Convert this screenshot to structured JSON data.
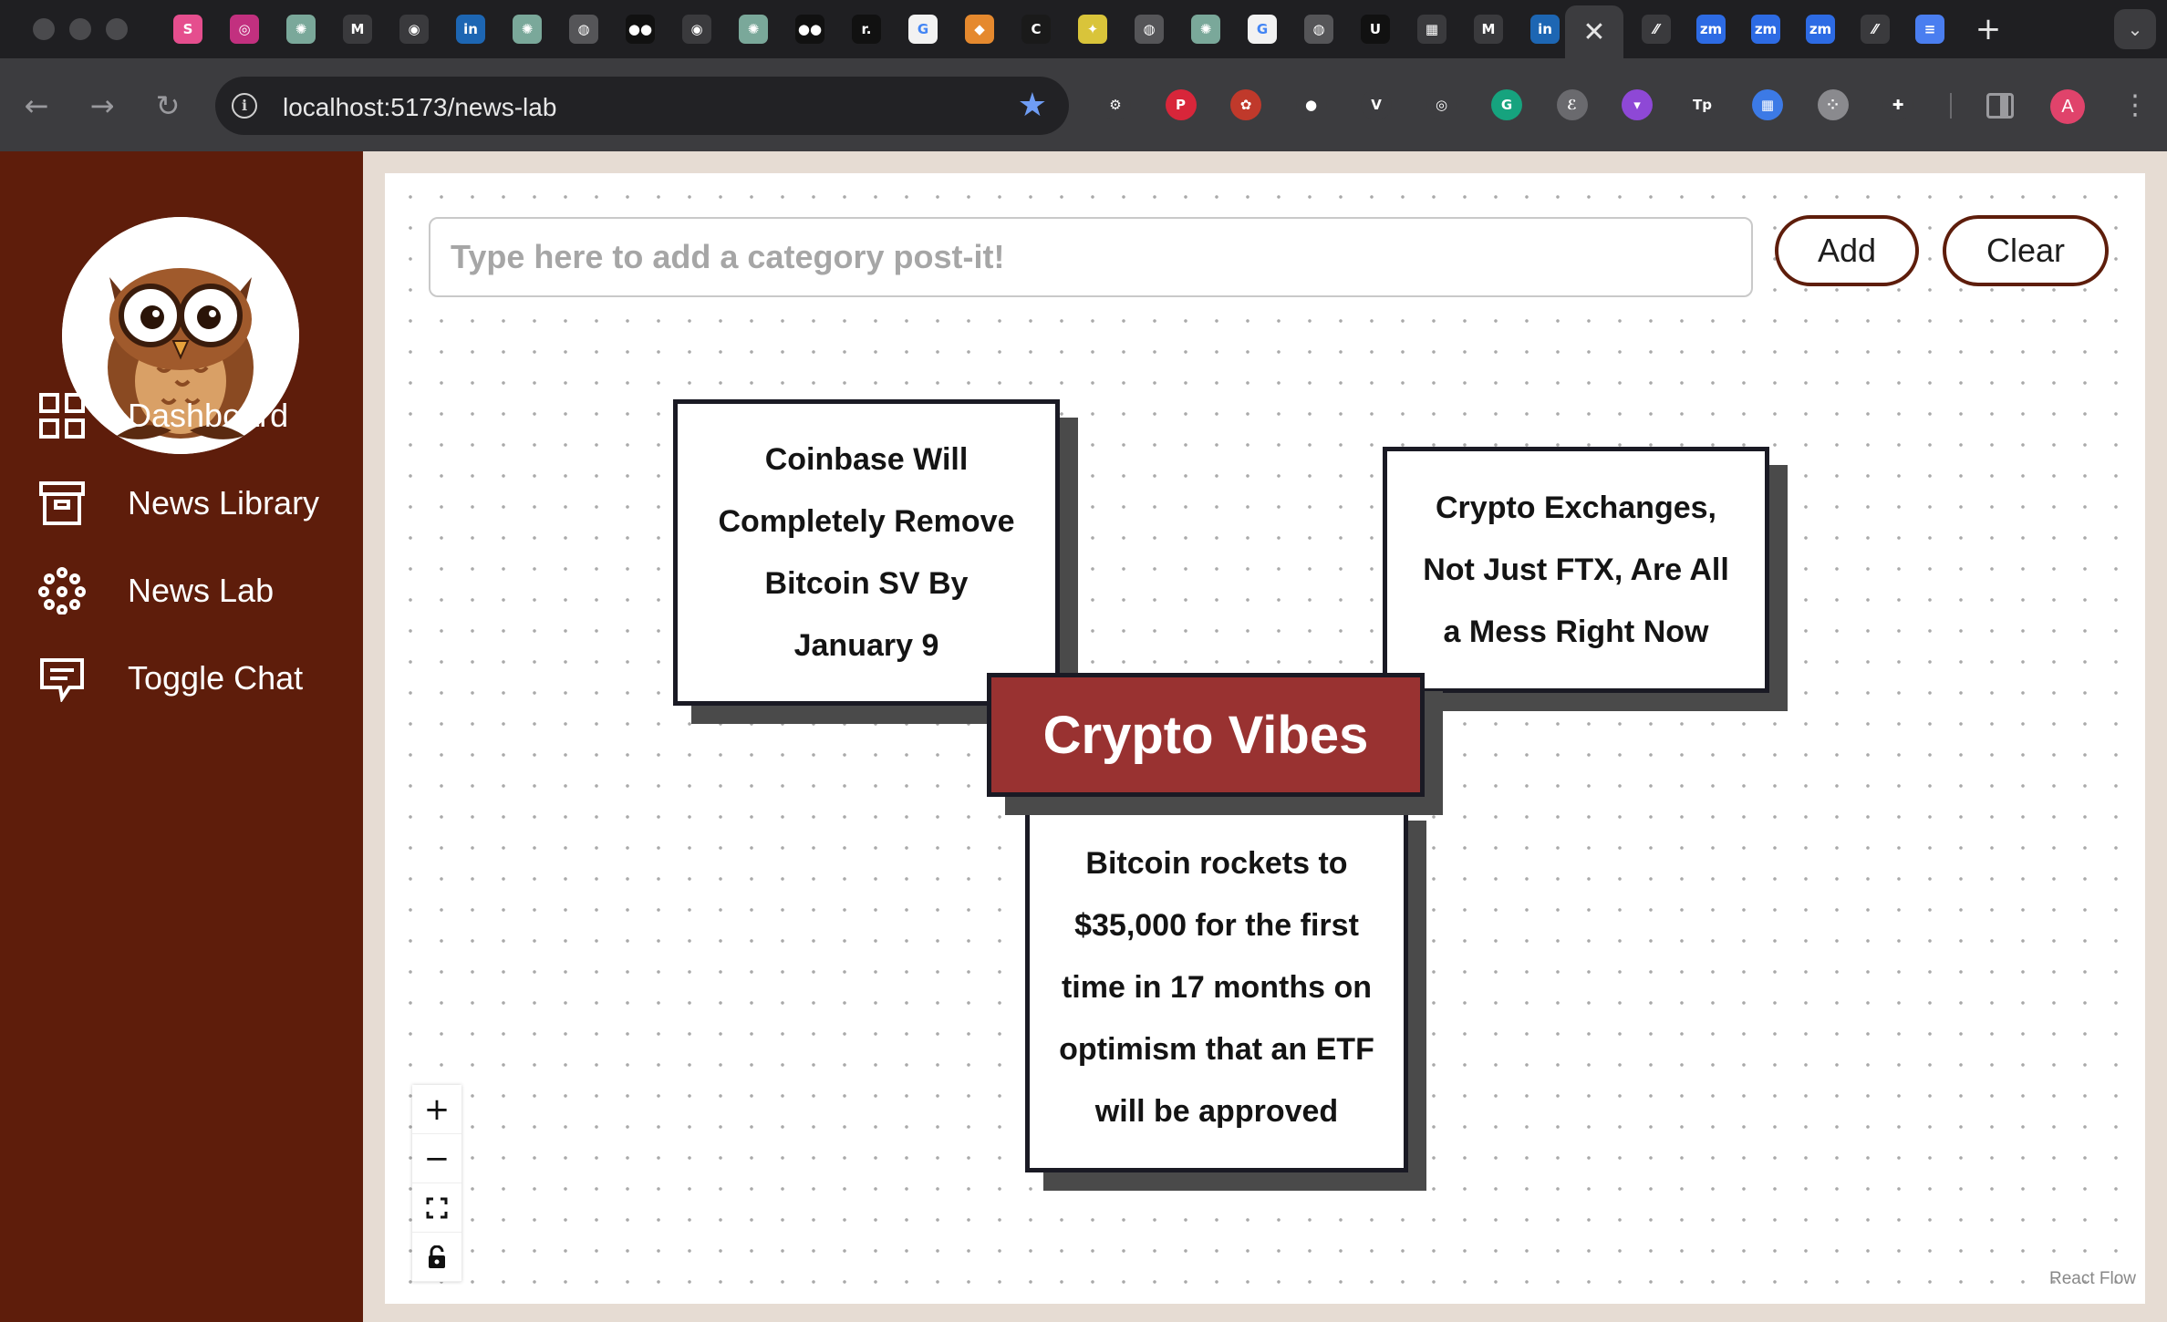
{
  "browser": {
    "active_tab_close_glyph": "✕",
    "new_tab_glyph": "+",
    "url": "localhost:5173/news-lab",
    "profile_initial": "A",
    "tab_favicons": [
      {
        "name": "s-icon",
        "glyph": "S",
        "color": "#e54e8e"
      },
      {
        "name": "circle-app-icon",
        "glyph": "◎",
        "color": "#c2307f"
      },
      {
        "name": "chatgpt-icon",
        "glyph": "✺",
        "color": "#7aa89a"
      },
      {
        "name": "gmail-icon",
        "glyph": "M",
        "color": "#3a3a3d"
      },
      {
        "name": "github-icon",
        "glyph": "◉",
        "color": "#3a3a3d"
      },
      {
        "name": "linkedin-icon",
        "glyph": "in",
        "color": "#1d66b3"
      },
      {
        "name": "chatgpt-icon",
        "glyph": "✺",
        "color": "#7aa89a"
      },
      {
        "name": "chrome-icon",
        "glyph": "◍",
        "color": "#555558"
      },
      {
        "name": "medium-icon",
        "glyph": "●●",
        "color": "#111111"
      },
      {
        "name": "github-icon",
        "glyph": "◉",
        "color": "#3a3a3d"
      },
      {
        "name": "chatgpt-icon",
        "glyph": "✺",
        "color": "#7aa89a"
      },
      {
        "name": "medium-icon",
        "glyph": "●●",
        "color": "#111111"
      },
      {
        "name": "r-app-icon",
        "glyph": "r.",
        "color": "#111111"
      },
      {
        "name": "google-icon",
        "glyph": "G",
        "color": "#f2f2f2"
      },
      {
        "name": "box-icon",
        "glyph": "◆",
        "color": "#e5892e"
      },
      {
        "name": "c-app-icon",
        "glyph": "C",
        "color": "#1a1a1a"
      },
      {
        "name": "figure-icon",
        "glyph": "✦",
        "color": "#d9c43a"
      },
      {
        "name": "chrome-icon",
        "glyph": "◍",
        "color": "#555558"
      },
      {
        "name": "chatgpt-icon",
        "glyph": "✺",
        "color": "#7aa89a"
      },
      {
        "name": "google-icon",
        "glyph": "G",
        "color": "#f2f2f2"
      },
      {
        "name": "chrome-icon",
        "glyph": "◍",
        "color": "#555558"
      },
      {
        "name": "ui-app-icon",
        "glyph": "U",
        "color": "#111111"
      },
      {
        "name": "grid-app-icon",
        "glyph": "▦",
        "color": "#3a3a3d"
      },
      {
        "name": "gmail-icon",
        "glyph": "M",
        "color": "#3a3a3d"
      },
      {
        "name": "linkedin-icon",
        "glyph": "in",
        "color": "#1d66b3"
      }
    ],
    "tabs_after_active": [
      {
        "name": "slash-app-icon",
        "glyph": "⁄⁄",
        "color": "#3a3a3d"
      },
      {
        "name": "zoom-icon",
        "glyph": "zm",
        "color": "#2d6be4"
      },
      {
        "name": "zoom-icon",
        "glyph": "zm",
        "color": "#2d6be4"
      },
      {
        "name": "zoom-icon",
        "glyph": "zm",
        "color": "#2d6be4"
      },
      {
        "name": "slash-app-icon",
        "glyph": "⁄⁄",
        "color": "#3a3a3d"
      },
      {
        "name": "docs-icon",
        "glyph": "≡",
        "color": "#4a7ef0"
      }
    ],
    "extensions": [
      {
        "name": "gear-extension-icon",
        "glyph": "⚙",
        "color": "#3c3c3f"
      },
      {
        "name": "pinterest-icon",
        "glyph": "P",
        "color": "#d8263a"
      },
      {
        "name": "paw-extension-icon",
        "glyph": "✿",
        "color": "#c0392b"
      },
      {
        "name": "chat-bubble-extension-icon",
        "glyph": "●",
        "color": "#3c3c3f"
      },
      {
        "name": "v-extension-icon",
        "glyph": "V",
        "color": "#3c3c3f"
      },
      {
        "name": "target-extension-icon",
        "glyph": "◎",
        "color": "#3c3c3f"
      },
      {
        "name": "grammarly-icon",
        "glyph": "G",
        "color": "#16a37e"
      },
      {
        "name": "e-extension-icon",
        "glyph": "ℰ",
        "color": "#6a6a6e"
      },
      {
        "name": "pocket-icon",
        "glyph": "▾",
        "color": "#8e48d6"
      },
      {
        "name": "tp-extension-icon",
        "glyph": "Tp",
        "color": "#3c3c3f"
      },
      {
        "name": "layout-extension-icon",
        "glyph": "▦",
        "color": "#3c7ae6"
      },
      {
        "name": "dots-extension-icon",
        "glyph": "⁘",
        "color": "#8a8a8e"
      },
      {
        "name": "puzzle-extensions-icon",
        "glyph": "✚",
        "color": "#3c3c3f"
      }
    ]
  },
  "sidebar": {
    "items": [
      {
        "label": "Dashboard"
      },
      {
        "label": "News Library"
      },
      {
        "label": "News Lab"
      },
      {
        "label": "Toggle Chat"
      }
    ]
  },
  "lab": {
    "input_placeholder": "Type here to add a category post-it!",
    "add_label": "Add",
    "clear_label": "Clear",
    "category": "Crypto Vibes",
    "notes": [
      "Coinbase Will Completely Remove Bitcoin SV By January 9",
      "Crypto Exchanges, Not Just FTX, Are All a Mess Right Now",
      "Bitcoin rockets to $35,000 for the first time in 17 months on optimism that an ETF will be approved"
    ],
    "controls": {
      "zoom_in": "+",
      "zoom_out": "−"
    },
    "attribution": "React Flow"
  },
  "colors": {
    "sidebar_bg": "#5e1d0b",
    "category_bg": "#993231",
    "main_bg": "#e6dcd3"
  }
}
